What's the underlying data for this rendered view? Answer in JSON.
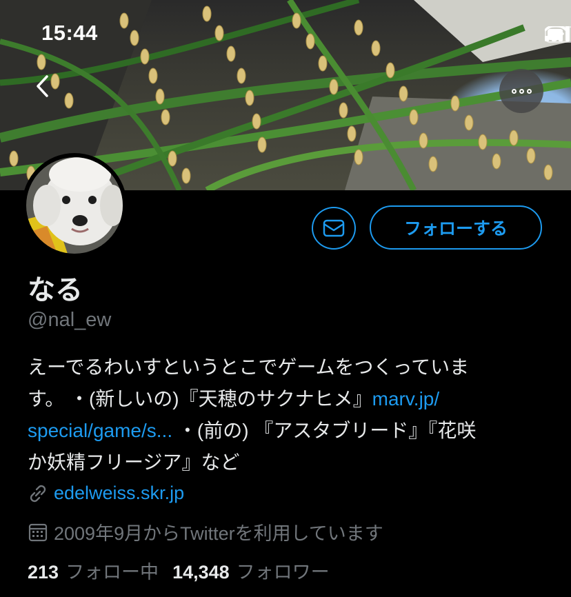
{
  "status_bar": {
    "time": "15:44"
  },
  "profile": {
    "display_name": "なる",
    "handle": "@nal_ew",
    "bio": {
      "line1": "えーでるわいすというとこでゲームをつくっていま",
      "line2_text": "す。 ・(新しいの)『天穂のサクナヒメ』",
      "line2_link": "marv.jp/",
      "line3_link": "special/game/s...",
      "line3_text": " ・(前の) 『アスタブリード』『花咲",
      "line4": "か妖精フリージア』など"
    },
    "website": "edelweiss.skr.jp",
    "joined": "2009年9月からTwitterを利用しています",
    "following_count": "213",
    "following_label": "フォロー中",
    "followers_count": "14,348",
    "followers_label": "フォロワー"
  },
  "actions": {
    "follow_label": "フォローする"
  },
  "icons": {
    "back": "chevron-left-icon",
    "more": "more-icon",
    "message": "mail-icon",
    "link": "link-icon",
    "calendar": "calendar-icon"
  },
  "colors": {
    "accent": "#1d9bf0",
    "muted": "#71767b",
    "background": "#000000",
    "text": "#e7e9ea"
  }
}
